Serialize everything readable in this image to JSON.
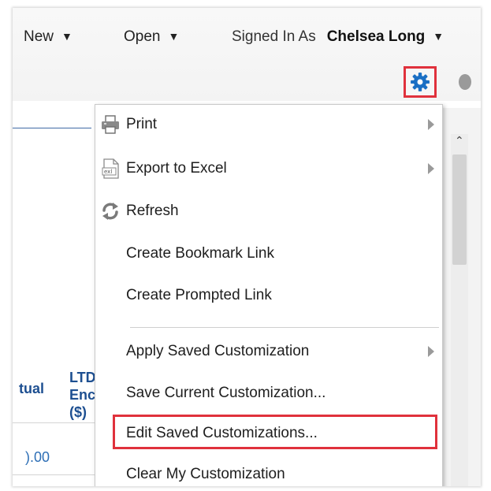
{
  "toolbar": {
    "new_label": "New",
    "open_label": "Open",
    "signed_in_label": "Signed In As",
    "user_name": "Chelsea Long"
  },
  "table": {
    "col1_header": "tual",
    "col2_header_lines": [
      "LTD",
      "Enc",
      "($)"
    ],
    "row1_value": ").00"
  },
  "menu": {
    "items": [
      {
        "label": "Print",
        "icon": "printer-icon",
        "submenu": true
      },
      {
        "label": "Export to Excel",
        "icon": "excel-icon",
        "submenu": true
      },
      {
        "label": "Refresh",
        "icon": "refresh-icon",
        "submenu": false
      },
      {
        "label": "Create Bookmark Link",
        "icon": "",
        "submenu": false
      },
      {
        "label": "Create Prompted Link",
        "icon": "",
        "submenu": false
      },
      {
        "label": "Apply Saved Customization",
        "icon": "",
        "submenu": true
      },
      {
        "label": "Save Current Customization...",
        "icon": "",
        "submenu": false
      },
      {
        "label": "Edit Saved Customizations...",
        "icon": "",
        "submenu": false
      },
      {
        "label": "Clear My Customization",
        "icon": "",
        "submenu": false
      }
    ]
  },
  "colors": {
    "highlight": "#e0313c",
    "link_blue": "#1d4f91",
    "gear_blue": "#1a6fc4"
  }
}
